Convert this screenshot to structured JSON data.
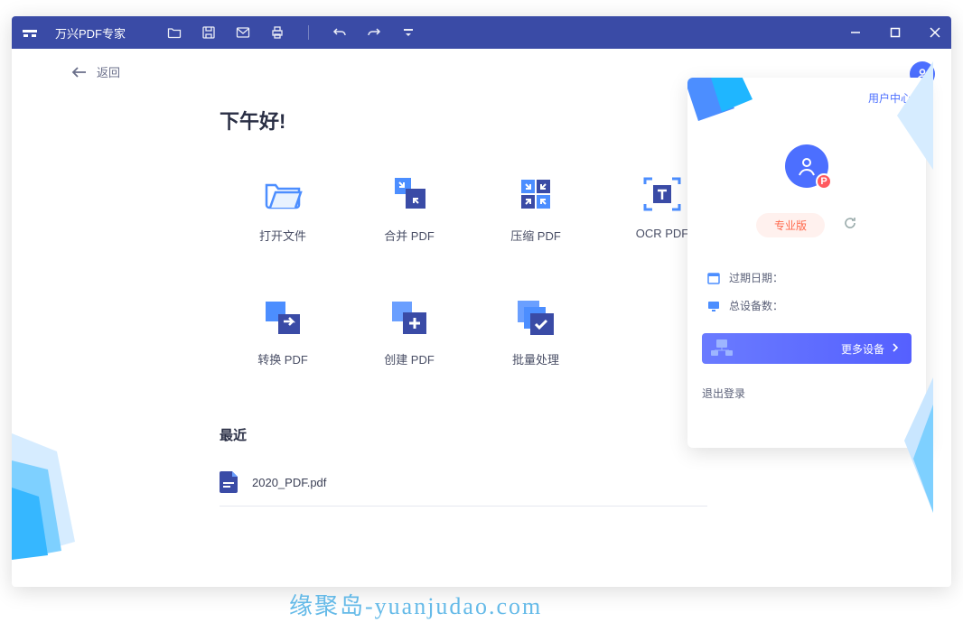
{
  "titlebar": {
    "app_title": "万兴PDF专家"
  },
  "back": {
    "label": "返回"
  },
  "main": {
    "greeting": "下午好!",
    "tiles": [
      {
        "label": "打开文件"
      },
      {
        "label": "合并 PDF"
      },
      {
        "label": "压缩 PDF"
      },
      {
        "label": "OCR PDF"
      },
      {
        "label": "转换 PDF"
      },
      {
        "label": "创建 PDF"
      },
      {
        "label": "批量处理"
      }
    ],
    "recent_header": "最近",
    "recent_files": [
      {
        "name": "2020_PDF.pdf"
      }
    ]
  },
  "panel": {
    "link": "用户中心",
    "badge": "P",
    "pill": "专业版",
    "expiry_label": "过期日期：",
    "devices_label": "总设备数：",
    "more_devices": "更多设备",
    "logout": "退出登录"
  },
  "watermark": "缘聚岛-yuanjudao.com",
  "colors": {
    "titlebar": "#3a4ba6",
    "accent": "#4c6fff",
    "pill_bg": "#fff1ee",
    "pill_fg": "#ff6a4d",
    "badge": "#ff5a5f"
  }
}
